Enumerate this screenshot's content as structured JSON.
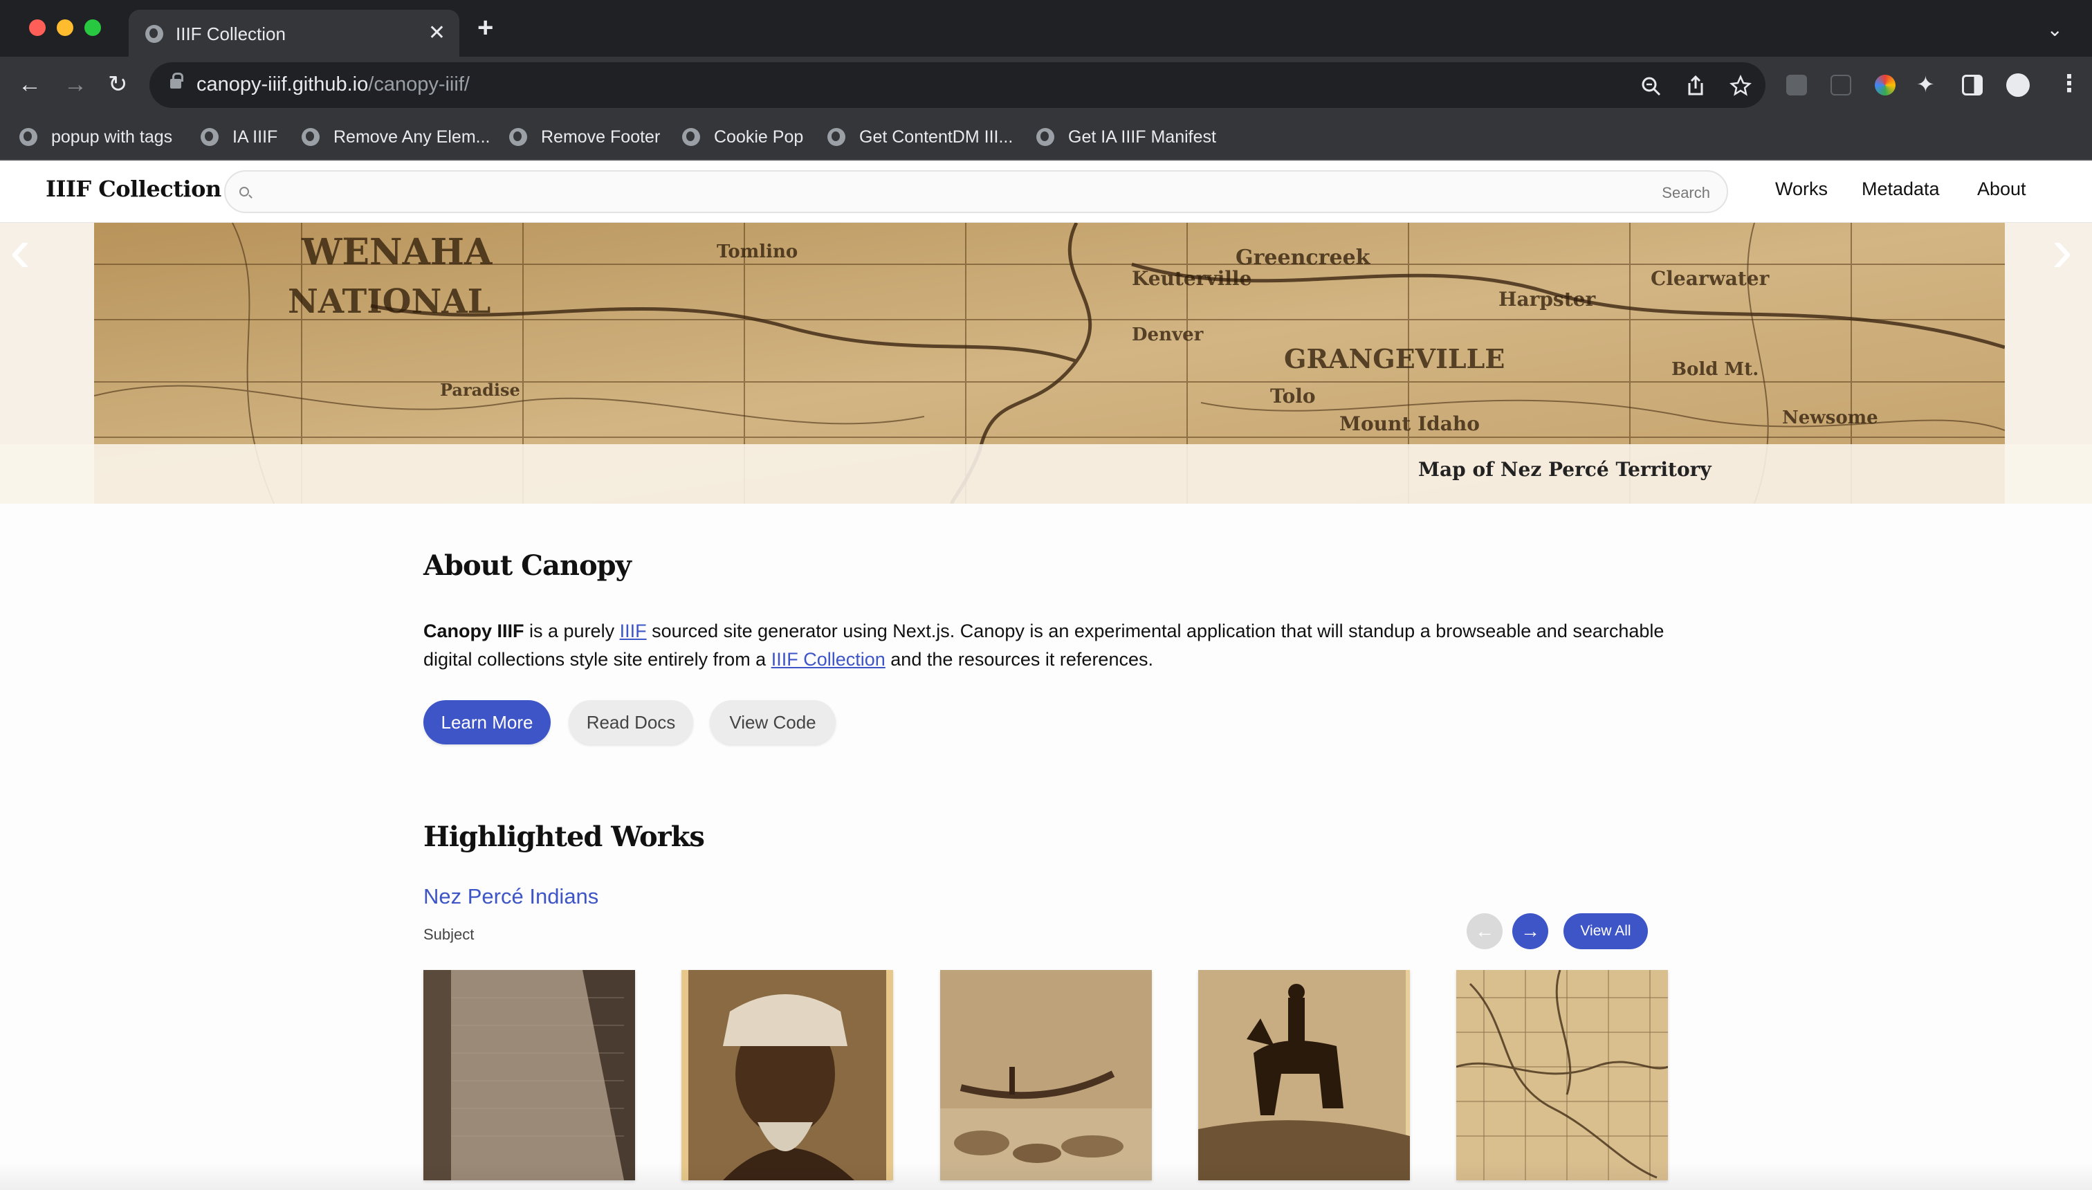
{
  "browser": {
    "tab_title": "IIIF Collection",
    "tab_close": "✕",
    "new_tab": "+",
    "url_host": "canopy-iiif.github.io",
    "url_path": "/canopy-iiif/",
    "bookmarks": [
      "popup with tags",
      "IA IIIF",
      "Remove Any Elem...",
      "Remove Footer",
      "Cookie Pop",
      "Get ContentDM III...",
      "Get IA IIIF Manifest"
    ]
  },
  "site": {
    "logo": "IIIF Collection",
    "search_label": "Search",
    "nav": [
      "Works",
      "Metadata",
      "About"
    ]
  },
  "hero": {
    "caption": "Map of Nez Percé Territory",
    "prev_arrow": "‹",
    "next_arrow": "›"
  },
  "about": {
    "heading": "About Canopy",
    "text_bold": "Canopy IIIF",
    "text_1": " is a purely ",
    "link_iiif": "IIIF",
    "text_2": " sourced site generator using Next.js. Canopy is an experimental application that will standup a browseable and searchable digital collections style site entirely from a ",
    "link_collection": "IIIF Collection",
    "text_3": " and the resources it references.",
    "buttons": [
      "Learn More",
      "Read Docs",
      "View Code"
    ]
  },
  "highlighted": {
    "heading": "Highlighted Works",
    "collection_title": "Nez Percé Indians",
    "collection_label": "Subject",
    "prev": "←",
    "next": "→",
    "view_all": "View All"
  },
  "colors": {
    "accent": "#3d55c7",
    "sepia": "#c8ab78"
  }
}
